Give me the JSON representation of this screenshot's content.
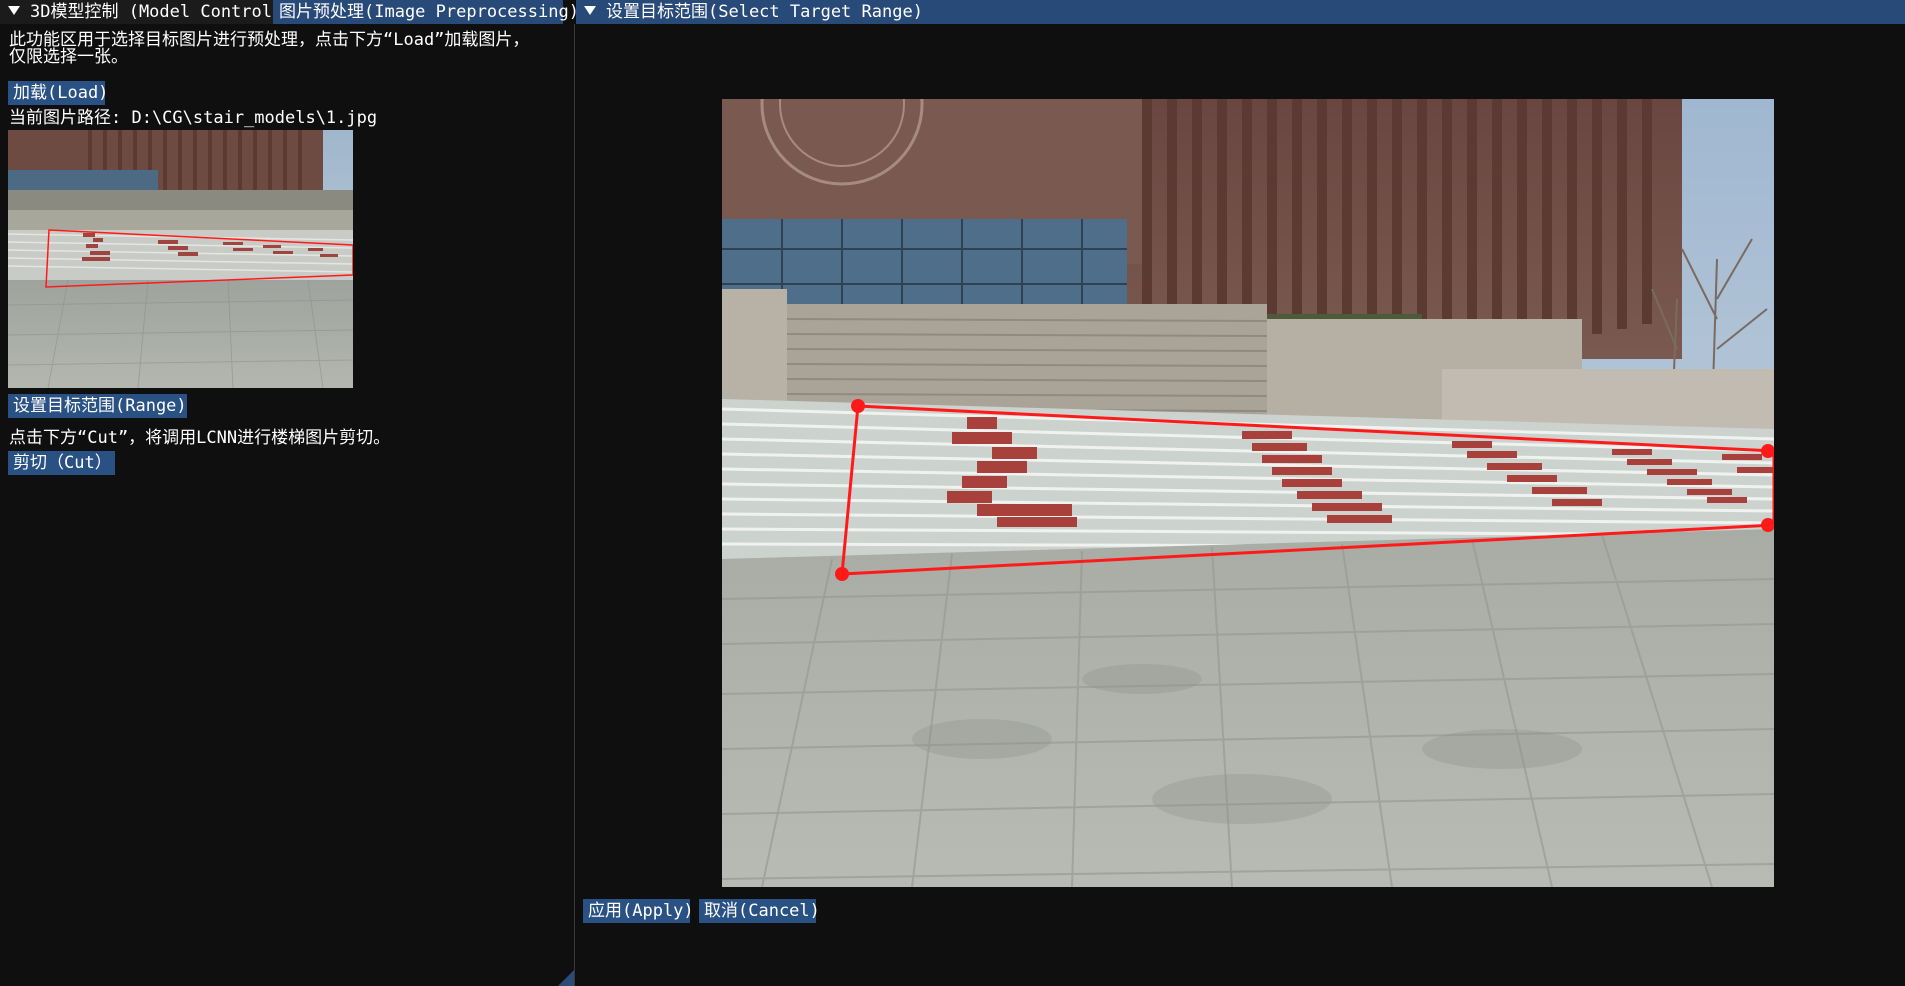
{
  "tabs": {
    "model_control": "3D模型控制 (Model Control)",
    "image_preprocessing": "图片预处理(Image Preprocessing)"
  },
  "left": {
    "description_line1": "此功能区用于选择目标图片进行预处理，点击下方“Load”加载图片，",
    "description_line2": "仅限选择一张。",
    "load_button": "加载(Load)",
    "path_label": "当前图片路径: D:\\CG\\stair_models\\1.jpg",
    "range_button": "设置目标范围(Range)",
    "cut_hint": "点击下方“Cut”，将调用LCNN进行楼梯图片剪切。",
    "cut_button": "剪切（Cut）"
  },
  "range_window": {
    "title": "设置目标范围(Select Target Range)",
    "apply_button": "应用(Apply)",
    "cancel_button": "取消(Cancel)"
  },
  "colors": {
    "accent": "#295183",
    "title_bar": "#284a78",
    "selection": "#ff1a1a",
    "background": "#0f0f0f"
  }
}
